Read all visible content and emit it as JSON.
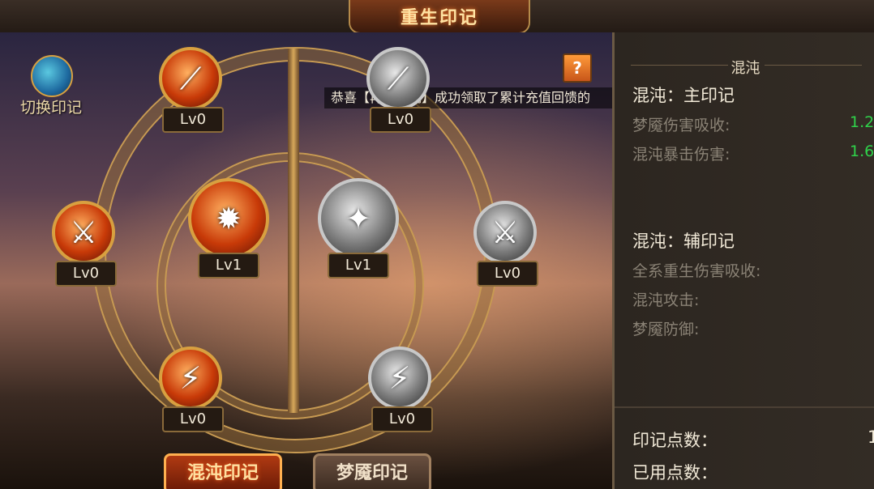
{
  "window": {
    "title": "重生印记"
  },
  "switch": {
    "label": "切换印记",
    "icon": "swap-arrows-icon"
  },
  "help": {
    "label": "?"
  },
  "ticker": {
    "text": "恭喜【再见江湖】成功领取了累计充值回馈的"
  },
  "chaos_nodes": [
    {
      "name": "arrow-burst",
      "icon": "⟋",
      "level": "Lv0"
    },
    {
      "name": "crossed-swords",
      "icon": "⚔",
      "level": "Lv0"
    },
    {
      "name": "core",
      "icon": "✹",
      "level": "Lv1"
    },
    {
      "name": "lightning-blade",
      "icon": "⚡",
      "level": "Lv0"
    }
  ],
  "nightmare_nodes": [
    {
      "name": "arrow-burst",
      "icon": "⟋",
      "level": "Lv0"
    },
    {
      "name": "crossed-swords",
      "icon": "⚔",
      "level": "Lv0"
    },
    {
      "name": "core",
      "icon": "✦",
      "level": "Lv1"
    },
    {
      "name": "lightning-blade",
      "icon": "⚡",
      "level": "Lv0"
    }
  ],
  "tabs": [
    {
      "label": "混沌印记",
      "active": true
    },
    {
      "label": "梦魇印记",
      "active": false
    }
  ],
  "panel": {
    "title": "混沌",
    "main_header": "混沌：主印记",
    "main_stats": [
      {
        "label": "梦魇伤害吸收:",
        "value": "1.2"
      },
      {
        "label": "混沌暴击伤害:",
        "value": "1.6"
      }
    ],
    "aux_header": "混沌：辅印记",
    "aux_stats": [
      {
        "label": "全系重生伤害吸收:"
      },
      {
        "label": "混沌攻击:"
      },
      {
        "label": "梦魇防御:"
      }
    ],
    "points_label": "印记点数：",
    "points_value": "1",
    "used_label": "已用点数："
  },
  "colors": {
    "accent": "#d8a040",
    "positive": "#2fd24a",
    "title": "#ffe3a3"
  }
}
